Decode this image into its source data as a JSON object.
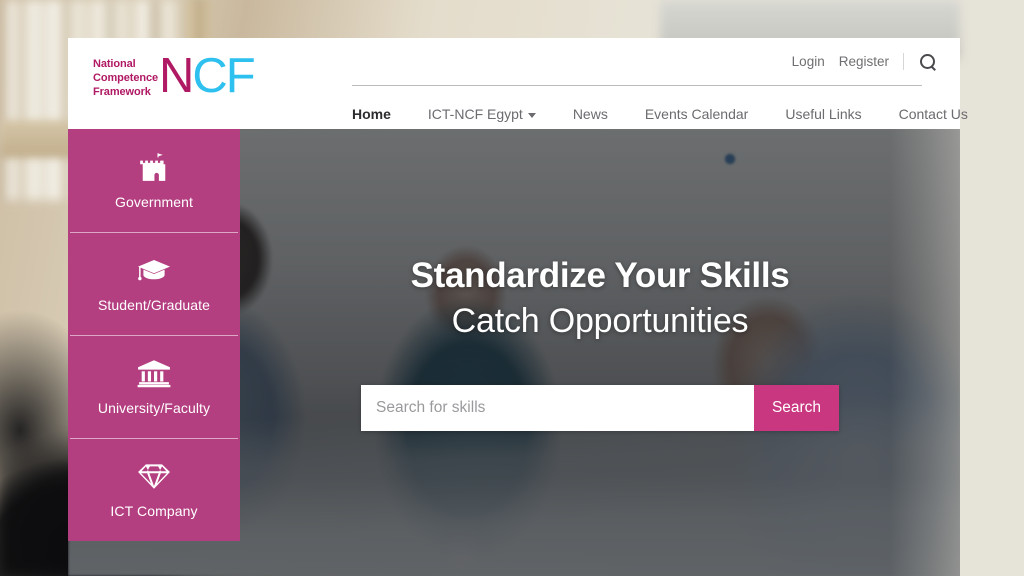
{
  "site": {
    "logo": {
      "line1": "National",
      "line2": "Competence",
      "line3": "Framework",
      "mark_n": "N",
      "mark_cf": "CF",
      "color_magenta": "#b01a64",
      "color_cyan": "#2ec0ee"
    },
    "top_nav": {
      "login": "Login",
      "register": "Register",
      "search_icon": "search-icon"
    },
    "main_nav": [
      {
        "label": "Home",
        "active": true,
        "has_dropdown": false
      },
      {
        "label": "ICT-NCF Egypt",
        "active": false,
        "has_dropdown": true
      },
      {
        "label": "News",
        "active": false,
        "has_dropdown": false
      },
      {
        "label": "Events Calendar",
        "active": false,
        "has_dropdown": false
      },
      {
        "label": "Useful Links",
        "active": false,
        "has_dropdown": false
      },
      {
        "label": "Contact Us",
        "active": false,
        "has_dropdown": false
      }
    ]
  },
  "sidebar": {
    "background_color": "#b43f80",
    "items": [
      {
        "label": "Government",
        "icon": "castle-icon"
      },
      {
        "label": "Student/Graduate",
        "icon": "graduation-cap-icon"
      },
      {
        "label": "University/Faculty",
        "icon": "classical-building-icon"
      },
      {
        "label": "ICT Company",
        "icon": "diamond-icon"
      }
    ]
  },
  "hero": {
    "headline": "Standardize Your Skills",
    "subheadline": "Catch Opportunities",
    "search": {
      "placeholder": "Search for skills",
      "value": "",
      "button_label": "Search",
      "button_color": "#c8377f"
    }
  }
}
